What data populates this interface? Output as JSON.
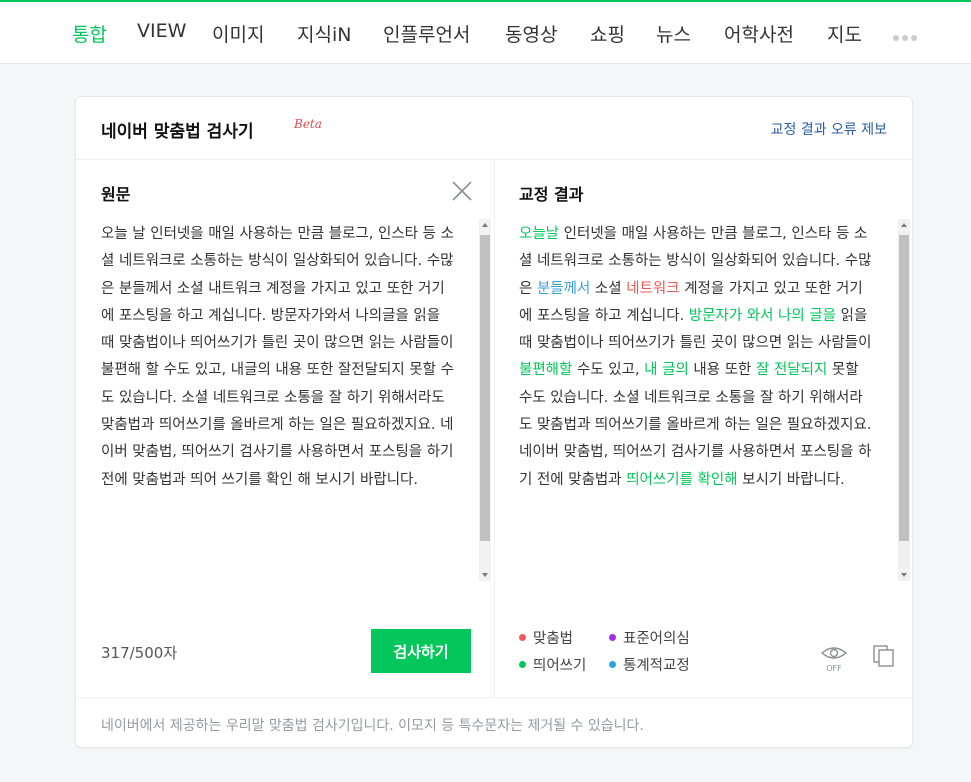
{
  "nav": {
    "tabs": [
      {
        "label": "통합",
        "active": true
      },
      {
        "label": "VIEW",
        "active": false
      },
      {
        "label": "이미지",
        "active": false
      },
      {
        "label": "지식iN",
        "active": false
      },
      {
        "label": "인플루언서",
        "active": false
      },
      {
        "label": "동영상",
        "active": false
      },
      {
        "label": "쇼핑",
        "active": false
      },
      {
        "label": "뉴스",
        "active": false
      },
      {
        "label": "어학사전",
        "active": false
      },
      {
        "label": "지도",
        "active": false
      }
    ],
    "more_icon": "more-dots-icon"
  },
  "card": {
    "title": "네이버 맞춤법 검사기",
    "beta": "Beta",
    "report_link": "교정 결과 오류 제보",
    "footer_text": "네이버에서 제공하는 우리말 맞춤법 검사기입니다. 이모지 등 특수문자는 제거될 수 있습니다."
  },
  "original": {
    "title": "원문",
    "text": "오늘 날 인터넷을 매일 사용하는 만큼 블로그, 인스타 등 소셜 네트워크로 소통하는 방식이 일상화되어 있습니다. 수많은 분들께서 소셜 내트워크 계정을 가지고 있고 또한 거기에 포스팅을 하고 계십니다. 방문자가와서 나의글을 읽을 때 맞춤법이나 띄어쓰기가 틀린 곳이 많으면 읽는 사람들이 불편해 할 수도 있고, 내글의 내용 또한 잘전달되지 못할 수도 있습니다. 소셜 네트워크로 소통을 잘 하기 위해서라도 맞춤법과 띄어쓰기를 올바르게 하는 일은 필요하겠지요. 네이버 맞춤법, 띄어쓰기 검사기를 사용하면서  포스팅을 하기 전에 맞춤법과 띄어 쓰기를 확인 해 보시기 바랍니다.",
    "char_count": "317/500자",
    "check_button": "검사하기"
  },
  "result": {
    "title": "교정 결과",
    "segments": [
      {
        "t": "오늘날",
        "c": "hl"
      },
      {
        "t": " 인터넷을 매일 사용하는 만큼 블로그, 인스타 등 소셜 네트워크로 소통하는 방식이 일상화되어 있습니다. 수많은 ",
        "c": ""
      },
      {
        "t": "분들께서",
        "c": "hl-blue"
      },
      {
        "t": " 소셜 ",
        "c": ""
      },
      {
        "t": "네트워크",
        "c": "hl-red"
      },
      {
        "t": " 계정을 가지고 있고 또한 거기에 포스팅을 하고 계십니다. ",
        "c": ""
      },
      {
        "t": "방문자가 와서 나의 글을",
        "c": "hl"
      },
      {
        "t": " 읽을 때 맞춤법이나 띄어쓰기가 틀린 곳이 많으면 읽는 사람들이 ",
        "c": ""
      },
      {
        "t": "불편해할",
        "c": "hl"
      },
      {
        "t": " 수도 있고, ",
        "c": ""
      },
      {
        "t": "내 글의",
        "c": "hl"
      },
      {
        "t": " 내용 또한 ",
        "c": ""
      },
      {
        "t": "잘 전달되지",
        "c": "hl"
      },
      {
        "t": " 못할 수도 있습니다. 소셜 네트워크로 소통을 잘 하기 위해서라도 맞춤법과 띄어쓰기를 올바르게 하는 일은 필요하겠지요. 네이버 맞춤법, 띄어쓰기 검사기를 사용하면서 포스팅을 하기 전에 맞춤법과 ",
        "c": ""
      },
      {
        "t": "띄어쓰기를 확인해",
        "c": "hl"
      },
      {
        "t": " 보시기 바랍니다.",
        "c": ""
      }
    ],
    "legend": [
      {
        "label": "맞춤법",
        "color": "#f0595c"
      },
      {
        "label": "표준어의심",
        "color": "#a52de0"
      },
      {
        "label": "띄어쓰기",
        "color": "#03c75a"
      },
      {
        "label": "통계적교정",
        "color": "#2ba3e0"
      }
    ],
    "eye_toggle": "OFF"
  }
}
